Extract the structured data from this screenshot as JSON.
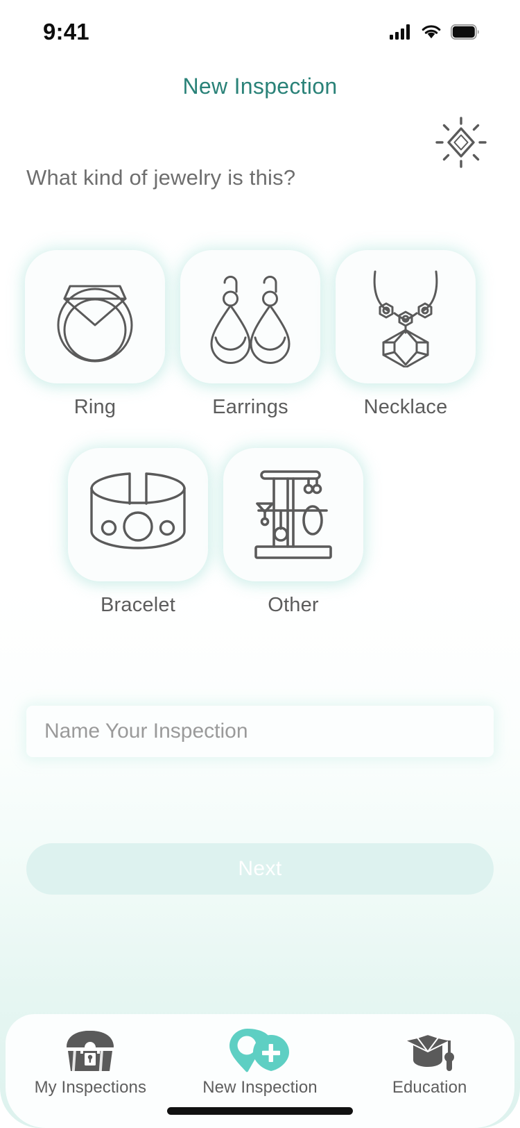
{
  "status_bar": {
    "time": "9:41",
    "icons": [
      "cellular-signal-icon",
      "wifi-icon",
      "battery-icon"
    ]
  },
  "header": {
    "title": "New Inspection",
    "decor_icon": "sparkle-diamond-icon"
  },
  "main": {
    "question": "What kind of jewelry is this?",
    "jewelry_types": [
      {
        "label": "Ring",
        "icon": "ring-icon"
      },
      {
        "label": "Earrings",
        "icon": "earrings-icon"
      },
      {
        "label": "Necklace",
        "icon": "necklace-icon"
      },
      {
        "label": "Bracelet",
        "icon": "bracelet-icon"
      },
      {
        "label": "Other",
        "icon": "jewelry-stand-icon"
      }
    ],
    "name_input": {
      "value": "",
      "placeholder": "Name Your Inspection"
    },
    "next_label": "Next"
  },
  "tab_bar": {
    "items": [
      {
        "label": "My Inspections",
        "icon": "treasure-chest-icon",
        "active": false
      },
      {
        "label": "New Inspection",
        "icon": "map-pin-plus-icon",
        "active": true
      },
      {
        "label": "Education",
        "icon": "graduation-cap-icon",
        "active": false
      }
    ]
  },
  "colors": {
    "accent_teal": "#5ECFC3",
    "title_teal": "#2A8278",
    "disabled_button_bg": "#DDF2EF",
    "icon_stroke": "#5A5A5A",
    "text_gray": "#5E5E5E",
    "placeholder_gray": "#9A9A9A",
    "page_bottom_mint": "#DDF2EE"
  }
}
